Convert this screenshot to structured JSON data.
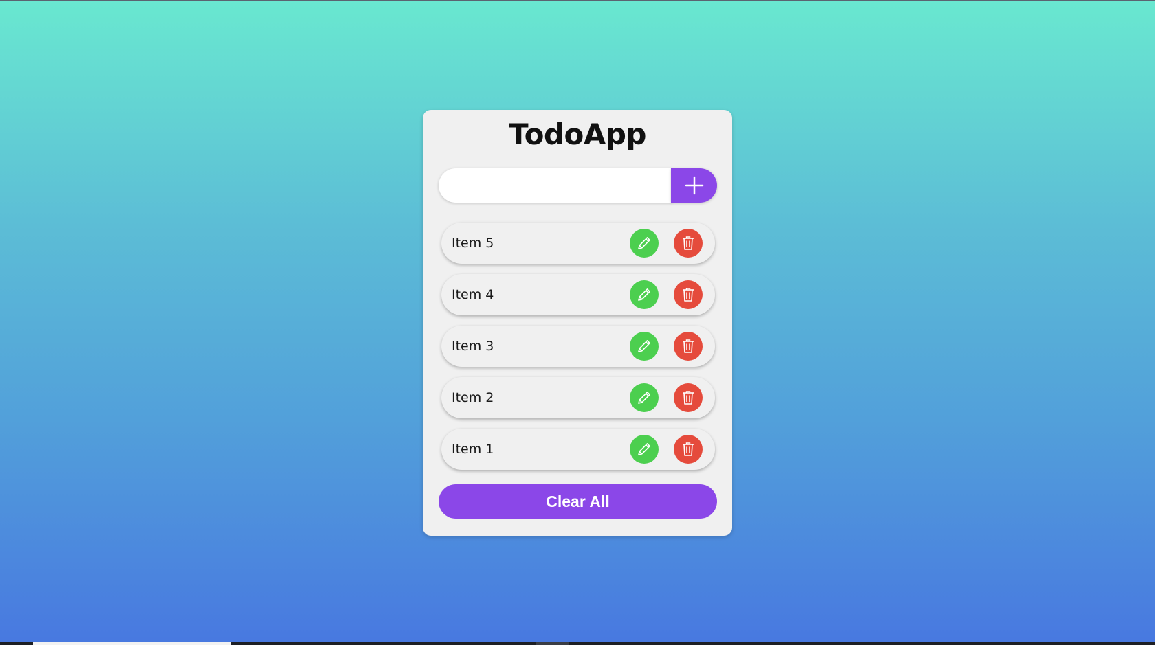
{
  "app": {
    "title": "TodoApp"
  },
  "add_form": {
    "input_value": "",
    "placeholder": "",
    "add_icon": "plus-icon"
  },
  "todos": [
    {
      "text": "Item 5",
      "edit_icon": "pencil-icon",
      "delete_icon": "trash-icon"
    },
    {
      "text": "Item 4",
      "edit_icon": "pencil-icon",
      "delete_icon": "trash-icon"
    },
    {
      "text": "Item 3",
      "edit_icon": "pencil-icon",
      "delete_icon": "trash-icon"
    },
    {
      "text": "Item 2",
      "edit_icon": "pencil-icon",
      "delete_icon": "trash-icon"
    },
    {
      "text": "Item 1",
      "edit_icon": "pencil-icon",
      "delete_icon": "trash-icon"
    }
  ],
  "footer": {
    "clear_label": "Clear All"
  },
  "colors": {
    "accent": "#8b47e8",
    "edit": "#4ccf4f",
    "delete": "#e54b3c",
    "card_bg": "#f0f0f0",
    "bg_top": "#69e8d0",
    "bg_bottom": "#4878e0"
  }
}
